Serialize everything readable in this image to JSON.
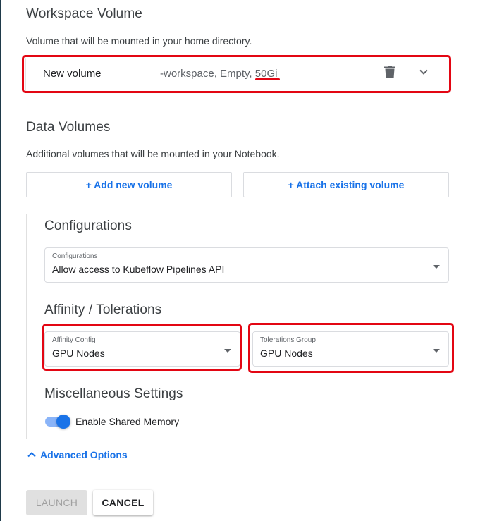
{
  "workspace": {
    "title": "Workspace Volume",
    "description": "Volume that will be mounted in your home directory.",
    "volume": {
      "name": "New volume",
      "meta_prefix": "-workspace, Empty, ",
      "size": "50Gi"
    },
    "icons": {
      "delete": "trash-icon",
      "expand": "chevron-down-icon"
    }
  },
  "data_volumes": {
    "title": "Data Volumes",
    "description": "Additional volumes that will be mounted in your Notebook.",
    "add_label": "+ Add new volume",
    "attach_label": "+ Attach existing volume"
  },
  "configurations": {
    "title": "Configurations",
    "field_label": "Configurations",
    "value": "Allow access to Kubeflow Pipelines API"
  },
  "affinity": {
    "title": "Affinity / Tolerations",
    "affinity_label": "Affinity Config",
    "affinity_value": "GPU Nodes",
    "tolerations_label": "Tolerations Group",
    "tolerations_value": "GPU Nodes"
  },
  "misc": {
    "title": "Miscellaneous Settings",
    "shared_memory_label": "Enable Shared Memory",
    "shared_memory_enabled": true
  },
  "advanced": {
    "label": "Advanced Options",
    "icon": "chevron-up-icon"
  },
  "actions": {
    "launch_label": "LAUNCH",
    "cancel_label": "CANCEL"
  },
  "colors": {
    "accent": "#1a73e8",
    "highlight": "#e30613"
  }
}
